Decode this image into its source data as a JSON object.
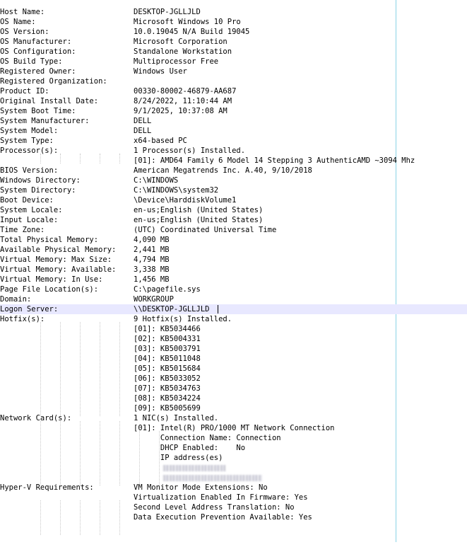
{
  "window": {
    "accent_line_color": "#8ad3e6",
    "current_line_color": "#e8e8ff"
  },
  "rows": [
    {
      "label": "Host Name:",
      "value": "DESKTOP-JGLLJLD"
    },
    {
      "label": "OS Name:",
      "value": "Microsoft Windows 10 Pro"
    },
    {
      "label": "OS Version:",
      "value": "10.0.19045 N/A Build 19045"
    },
    {
      "label": "OS Manufacturer:",
      "value": "Microsoft Corporation"
    },
    {
      "label": "OS Configuration:",
      "value": "Standalone Workstation"
    },
    {
      "label": "OS Build Type:",
      "value": "Multiprocessor Free"
    },
    {
      "label": "Registered Owner:",
      "value": "Windows User"
    },
    {
      "label": "Registered Organization:",
      "value": ""
    },
    {
      "label": "Product ID:",
      "value": "00330-80002-46879-AA687"
    },
    {
      "label": "Original Install Date:",
      "value": "8/24/2022, 11:10:44 AM"
    },
    {
      "label": "System Boot Time:",
      "value": "9/1/2025, 10:37:08 AM"
    },
    {
      "label": "System Manufacturer:",
      "value": "DELL"
    },
    {
      "label": "System Model:",
      "value": "DELL"
    },
    {
      "label": "System Type:",
      "value": "x64-based PC"
    },
    {
      "label": "Processor(s):",
      "value": "1 Processor(s) Installed."
    },
    {
      "label": "",
      "value": "[01]: AMD64 Family 6 Model 14 Stepping 3 AuthenticAMD ~3094 Mhz"
    },
    {
      "label": "BIOS Version:",
      "value": "American Megatrends Inc. A.40, 9/10/2018"
    },
    {
      "label": "Windows Directory:",
      "value": "C:\\WINDOWS"
    },
    {
      "label": "System Directory:",
      "value": "C:\\WINDOWS\\system32"
    },
    {
      "label": "Boot Device:",
      "value": "\\Device\\HarddiskVolume1"
    },
    {
      "label": "System Locale:",
      "value": "en-us;English (United States)"
    },
    {
      "label": "Input Locale:",
      "value": "en-us;English (United States)"
    },
    {
      "label": "Time Zone:",
      "value": "(UTC) Coordinated Universal Time"
    },
    {
      "label": "Total Physical Memory:",
      "value": "4,090 MB"
    },
    {
      "label": "Available Physical Memory:",
      "value": "2,441 MB"
    },
    {
      "label": "Virtual Memory: Max Size:",
      "value": "4,794 MB"
    },
    {
      "label": "Virtual Memory: Available:",
      "value": "3,338 MB"
    },
    {
      "label": "Virtual Memory: In Use:",
      "value": "1,456 MB"
    },
    {
      "label": "Page File Location(s):",
      "value": "C:\\pagefile.sys"
    },
    {
      "label": "Domain:",
      "value": "WORKGROUP"
    },
    {
      "label": "Logon Server:",
      "value": "\\\\DESKTOP-JGLLJLD"
    },
    {
      "label": "Hotfix(s):",
      "value": "9 Hotfix(s) Installed."
    },
    {
      "label": "",
      "value": "[01]: KB5034466"
    },
    {
      "label": "",
      "value": "[02]: KB5004331"
    },
    {
      "label": "",
      "value": "[03]: KB5003791"
    },
    {
      "label": "",
      "value": "[04]: KB5011048"
    },
    {
      "label": "",
      "value": "[05]: KB5015684"
    },
    {
      "label": "",
      "value": "[06]: KB5033052"
    },
    {
      "label": "",
      "value": "[07]: KB5034763"
    },
    {
      "label": "",
      "value": "[08]: KB5034224"
    },
    {
      "label": "",
      "value": "[09]: KB5005699"
    },
    {
      "label": "Network Card(s):",
      "value": "1 NIC(s) Installed."
    },
    {
      "label": "",
      "value": "[01]: Intel(R) PRO/1000 MT Network Connection"
    },
    {
      "label": "",
      "value": "      Connection Name: Connection"
    },
    {
      "label": "",
      "value": "      DHCP Enabled:    No"
    },
    {
      "label": "",
      "value": "      IP address(es)"
    },
    {
      "label": "",
      "value": ""
    },
    {
      "label": "",
      "value": ""
    },
    {
      "label": "Hyper-V Requirements:",
      "value": "VM Monitor Mode Extensions: No"
    },
    {
      "label": "",
      "value": "Virtualization Enabled In Firmware: Yes"
    },
    {
      "label": "",
      "value": "Second Level Address Translation: No"
    },
    {
      "label": "",
      "value": "Data Execution Prevention Available: Yes"
    }
  ]
}
